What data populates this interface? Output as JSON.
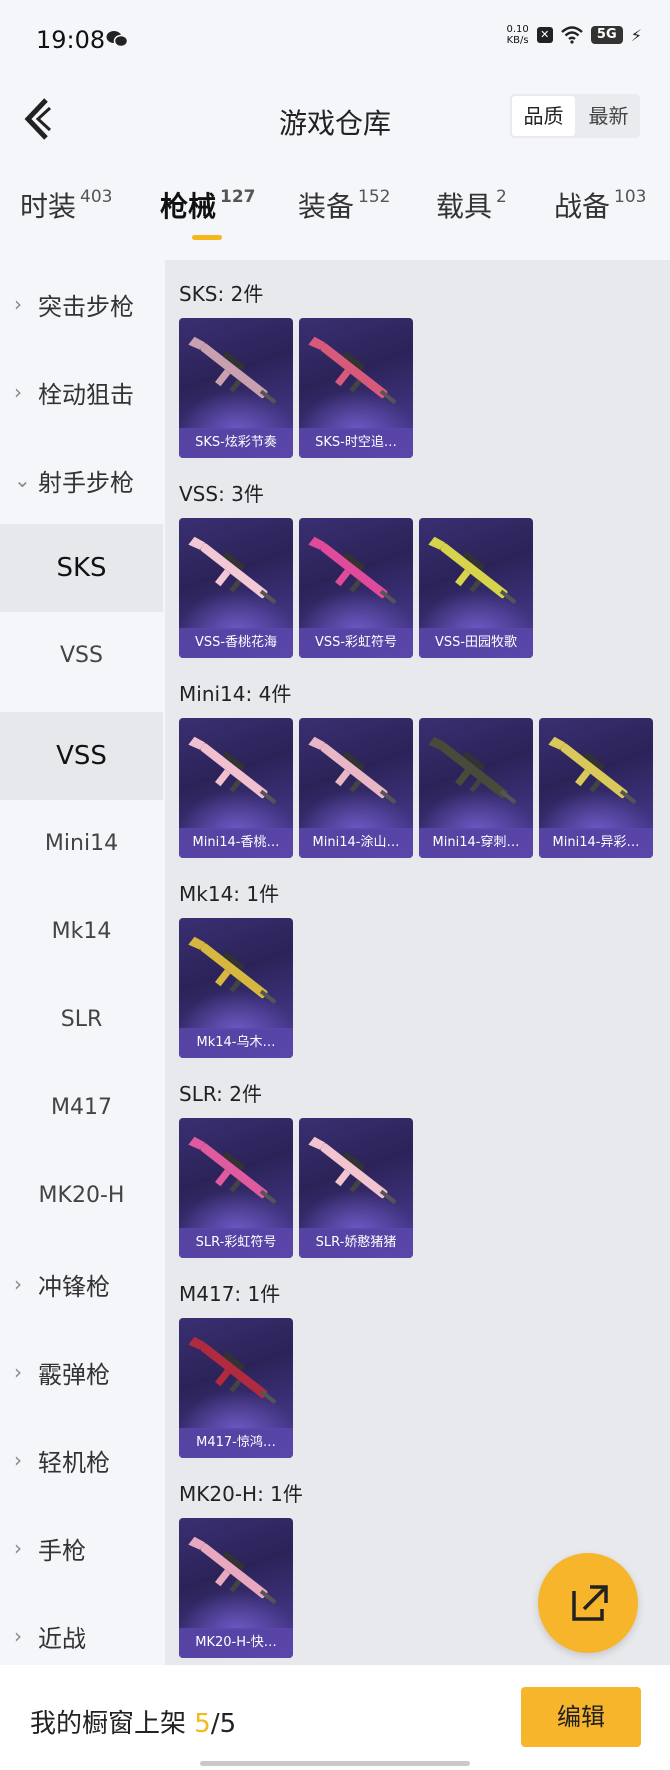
{
  "status": {
    "time": "19:08",
    "speed_top": "0.10",
    "speed_unit": "KB/s",
    "signal": "5G"
  },
  "header": {
    "title": "游戏仓库",
    "sort_quality": "品质",
    "sort_latest": "最新"
  },
  "tabs": [
    {
      "label": "时装",
      "count": "403"
    },
    {
      "label": "枪械",
      "count": "127"
    },
    {
      "label": "装备",
      "count": "152"
    },
    {
      "label": "载具",
      "count": "2"
    },
    {
      "label": "战备",
      "count": "103"
    }
  ],
  "sidebar": {
    "assault": "突击步枪",
    "bolt": "栓动狙击",
    "marksman": "射手步枪",
    "subs": [
      "SKS",
      "VSS",
      "VSS",
      "Mini14",
      "Mk14",
      "SLR",
      "M417",
      "MK20-H"
    ],
    "smg": "冲锋枪",
    "shotgun": "霰弹枪",
    "lmg": "轻机枪",
    "pistol": "手枪",
    "melee": "近战"
  },
  "groups": [
    {
      "title": "SKS: 2件",
      "items": [
        "SKS-炫彩节奏",
        "SKS-时空追…"
      ]
    },
    {
      "title": "VSS: 3件",
      "items": [
        "VSS-香桃花海",
        "VSS-彩虹符号",
        "VSS-田园牧歌"
      ]
    },
    {
      "title": "Mini14: 4件",
      "items": [
        "Mini14-香桃…",
        "Mini14-涂山…",
        "Mini14-穿刺…",
        "Mini14-异彩…"
      ]
    },
    {
      "title": "Mk14: 1件",
      "items": [
        "Mk14-乌木…"
      ]
    },
    {
      "title": "SLR: 2件",
      "items": [
        "SLR-彩虹符号",
        "SLR-娇憨猪猪"
      ]
    },
    {
      "title": "M417: 1件",
      "items": [
        "M417-惊鸿…"
      ]
    },
    {
      "title": "MK20-H: 1件",
      "items": [
        "MK20-H-快…"
      ]
    }
  ],
  "gun_colors": [
    [
      "#c9a0b0",
      "#d85a7a"
    ],
    [
      "#f2c7d6",
      "#e04a9a",
      "#d7d34a"
    ],
    [
      "#f0c0d0",
      "#e9b6c6",
      "#4a4a3a",
      "#d9c85a"
    ],
    [
      "#d6b840"
    ],
    [
      "#e05aa0",
      "#f1c4d0"
    ],
    [
      "#b02a40"
    ],
    [
      "#e8a8c0"
    ]
  ],
  "bottom": {
    "shelf_prefix": "我的橱窗上架 ",
    "shelf_count": "5",
    "shelf_total": "/5",
    "edit": "编辑"
  }
}
